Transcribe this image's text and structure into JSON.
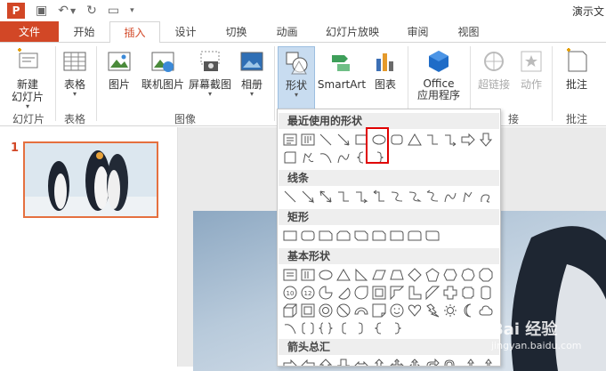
{
  "qat": {
    "app_badge": "P",
    "doc_title": "演示文"
  },
  "tabs": [
    "文件",
    "开始",
    "插入",
    "设计",
    "切换",
    "动画",
    "幻灯片放映",
    "审阅",
    "视图"
  ],
  "ribbon": {
    "new_slide": "新建\n幻灯片",
    "table": "表格",
    "picture": "图片",
    "online_picture": "联机图片",
    "screenshot": "屏幕截图",
    "album": "相册",
    "shapes": "形状",
    "smartart": "SmartArt",
    "chart": "图表",
    "office_apps": "Office\n应用程序",
    "hyperlink": "超链接",
    "action": "动作",
    "comment": "批注",
    "groups": {
      "slides": "幻灯片",
      "tables": "表格",
      "images": "图像",
      "links": "接",
      "comments": "批注"
    }
  },
  "sidebar": {
    "slide_number": "1"
  },
  "dropdown": {
    "sections": [
      "最近使用的形状",
      "线条",
      "矩形",
      "基本形状",
      "箭头总汇"
    ]
  },
  "watermark": {
    "main": "Bai 经验",
    "sub": "jingyan.baidu.com"
  },
  "colors": {
    "accent": "#d24726",
    "highlight": "#e00000",
    "selection": "#e5703f"
  }
}
